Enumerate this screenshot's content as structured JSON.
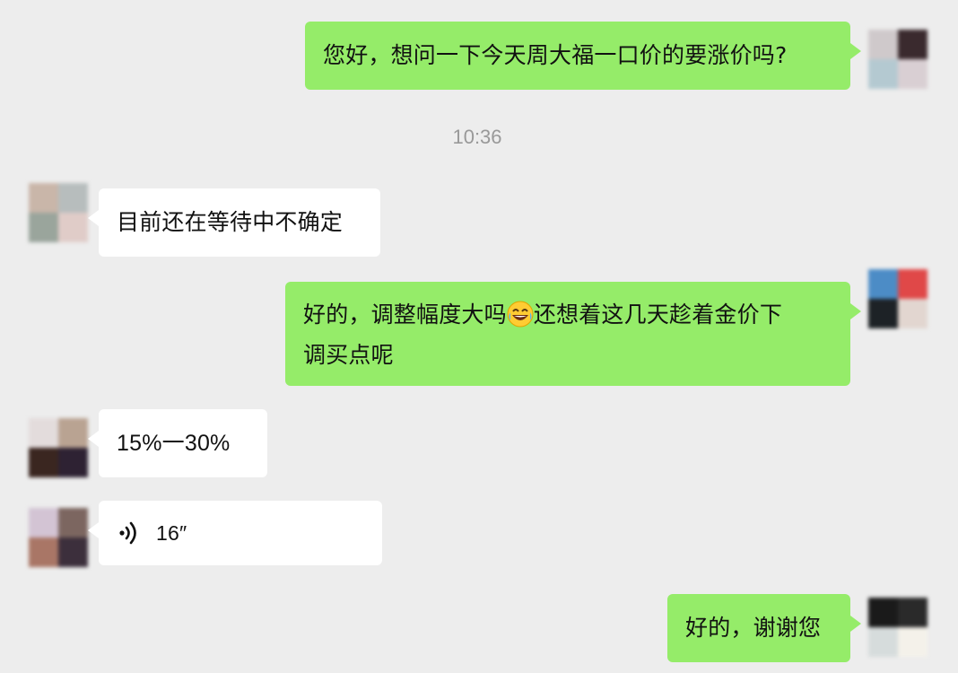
{
  "timestamp": "10:36",
  "messages": [
    {
      "id": "m1",
      "from": "me",
      "text": "您好，想问一下今天周大福一口价的要涨价吗?"
    },
    {
      "id": "m2",
      "from": "them",
      "text": "目前还在等待中不确定"
    },
    {
      "id": "m3",
      "from": "me",
      "text_part1": "好的，调整幅度大吗",
      "emoji": "joy-emoji",
      "text_part2": "还想着这几天趁着金价下",
      "text_line2": "调买点呢"
    },
    {
      "id": "m4",
      "from": "them",
      "text": "15%一30%"
    },
    {
      "id": "m5",
      "from": "them",
      "type": "voice",
      "duration": "16″",
      "icon": "voice-wave-icon"
    },
    {
      "id": "m6",
      "from": "me",
      "text": "好的，谢谢您"
    }
  ],
  "colors": {
    "background": "#ededed",
    "sent_bubble": "#95ec69",
    "received_bubble": "#ffffff",
    "timestamp": "#999999"
  }
}
